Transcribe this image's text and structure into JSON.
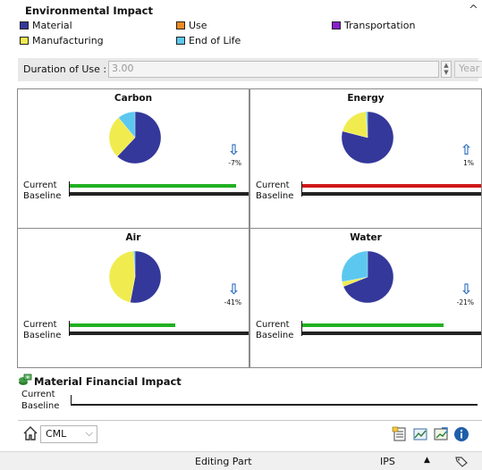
{
  "header": {
    "title": "Environmental Impact",
    "collapse_glyph": "^"
  },
  "legend": [
    {
      "label": "Material",
      "color": "#34389a"
    },
    {
      "label": "Use",
      "color": "#ef8a1f"
    },
    {
      "label": "Transportation",
      "color": "#8a1fcf"
    },
    {
      "label": "Manufacturing",
      "color": "#f0ec50"
    },
    {
      "label": "End of Life",
      "color": "#5cc8ef"
    }
  ],
  "duration": {
    "label": "Duration of Use :",
    "value": "3.00",
    "unit": "Year"
  },
  "panels": [
    {
      "title": "Carbon",
      "trend": "down",
      "change": "-7%",
      "current_fraction": 0.93,
      "current_color": "#22b022",
      "pie": [
        {
          "segment": "Material",
          "fraction": 0.62
        },
        {
          "segment": "Manufacturing",
          "fraction": 0.27
        },
        {
          "segment": "End of Life",
          "fraction": 0.11
        }
      ]
    },
    {
      "title": "Energy",
      "trend": "up",
      "change": "1%",
      "current_fraction": 1.0,
      "current_color": "#d01818",
      "pie": [
        {
          "segment": "Material",
          "fraction": 0.79
        },
        {
          "segment": "Manufacturing",
          "fraction": 0.2
        },
        {
          "segment": "End of Life",
          "fraction": 0.01
        }
      ]
    },
    {
      "title": "Air",
      "trend": "down",
      "change": "-41%",
      "current_fraction": 0.59,
      "current_color": "#22b022",
      "pie": [
        {
          "segment": "Material",
          "fraction": 0.53
        },
        {
          "segment": "Manufacturing",
          "fraction": 0.46
        },
        {
          "segment": "End of Life",
          "fraction": 0.01
        }
      ]
    },
    {
      "title": "Water",
      "trend": "down",
      "change": "-21%",
      "current_fraction": 0.79,
      "current_color": "#22b022",
      "pie": [
        {
          "segment": "Material",
          "fraction": 0.69
        },
        {
          "segment": "Manufacturing",
          "fraction": 0.03
        },
        {
          "segment": "End of Life",
          "fraction": 0.28
        }
      ]
    }
  ],
  "labels": {
    "current": "Current",
    "baseline": "Baseline"
  },
  "financial": {
    "title": "Material Financial Impact"
  },
  "toolbar": {
    "unit_system": "CML"
  },
  "status": {
    "text": "Editing Part",
    "units": "IPS",
    "caret": "▲"
  }
}
